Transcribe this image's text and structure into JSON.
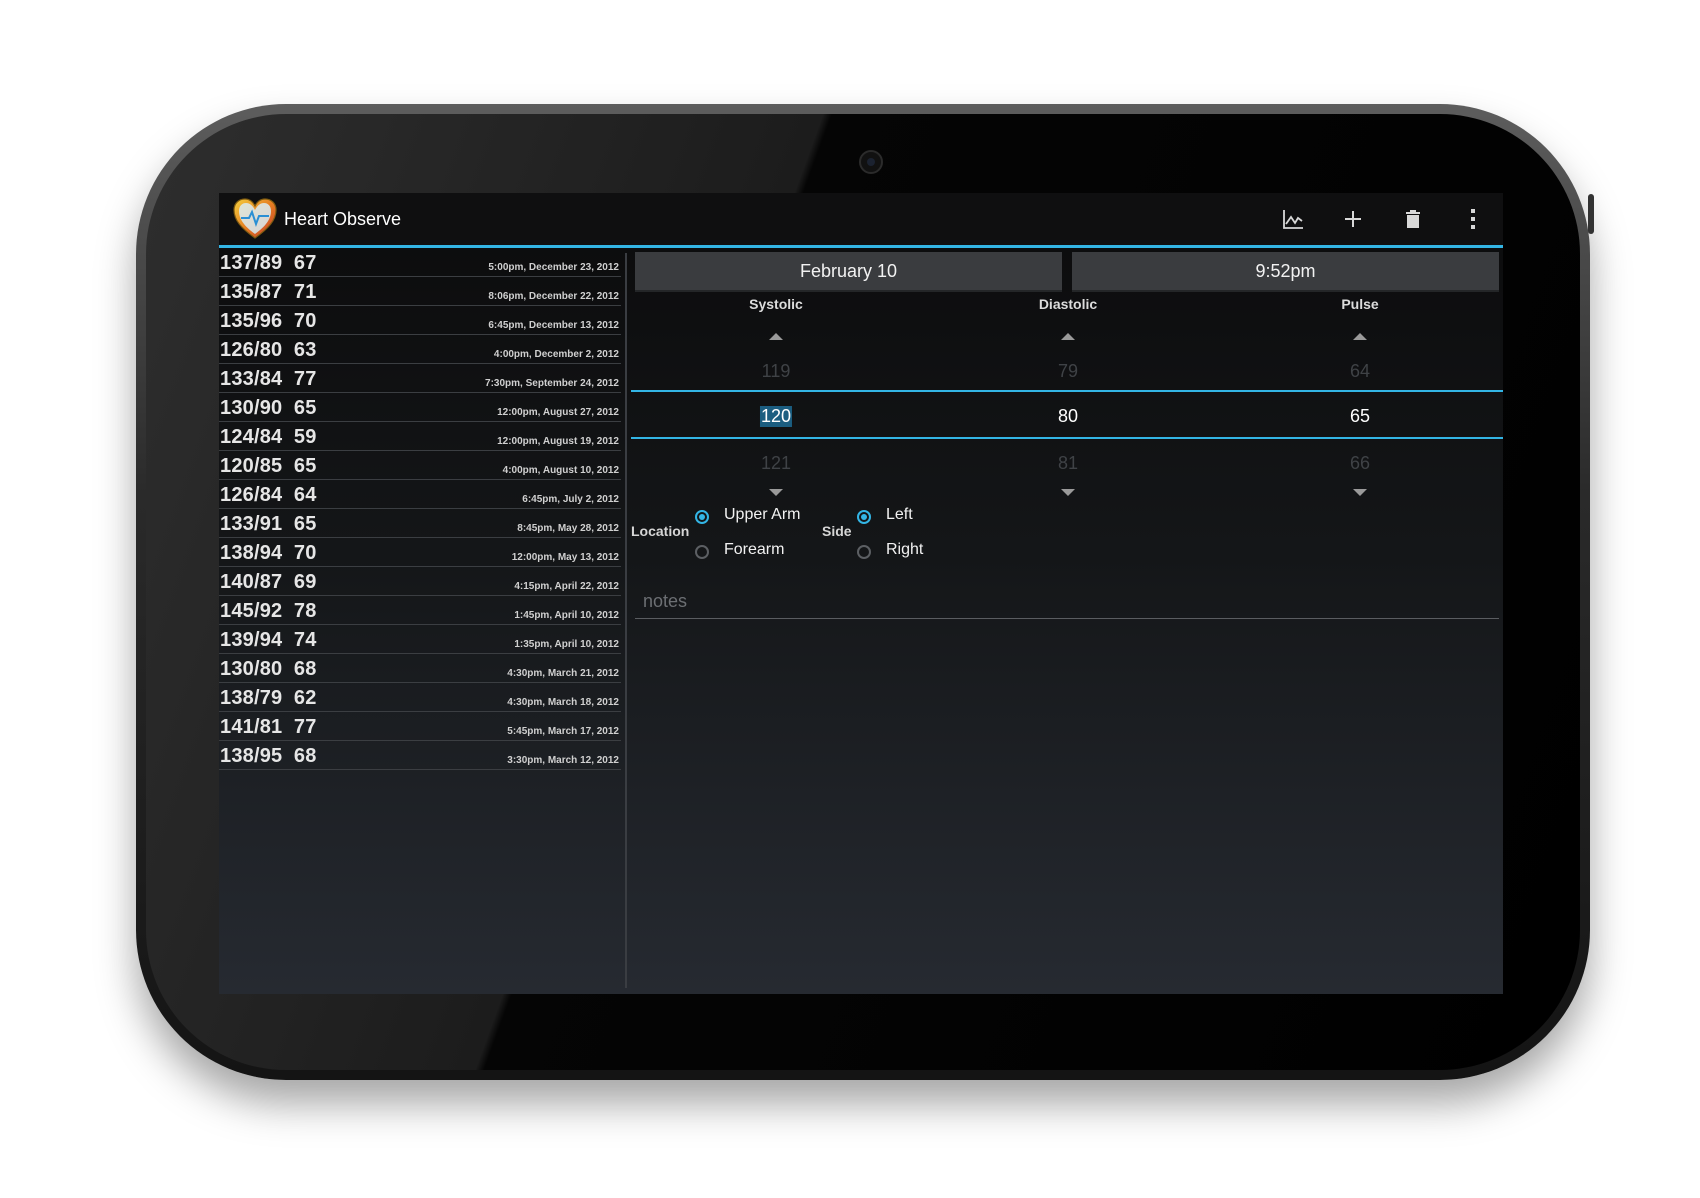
{
  "app": {
    "title": "Heart Observe",
    "icon": "heart-logo-icon"
  },
  "actions": [
    {
      "name": "chart-button",
      "icon": "chart-line-icon"
    },
    {
      "name": "add-button",
      "icon": "plus-icon"
    },
    {
      "name": "delete-button",
      "icon": "trash-icon"
    },
    {
      "name": "overflow-menu-button",
      "icon": "more-vertical-icon"
    }
  ],
  "readings": [
    {
      "bp": "137/89",
      "pulse": "67",
      "when": "5:00pm, December 23, 2012"
    },
    {
      "bp": "135/87",
      "pulse": "71",
      "when": "8:06pm, December 22, 2012"
    },
    {
      "bp": "135/96",
      "pulse": "70",
      "when": "6:45pm, December 13, 2012"
    },
    {
      "bp": "126/80",
      "pulse": "63",
      "when": "4:00pm, December 2, 2012"
    },
    {
      "bp": "133/84",
      "pulse": "77",
      "when": "7:30pm, September 24, 2012"
    },
    {
      "bp": "130/90",
      "pulse": "65",
      "when": "12:00pm, August 27, 2012"
    },
    {
      "bp": "124/84",
      "pulse": "59",
      "when": "12:00pm, August 19, 2012"
    },
    {
      "bp": "120/85",
      "pulse": "65",
      "when": "4:00pm, August 10, 2012"
    },
    {
      "bp": "126/84",
      "pulse": "64",
      "when": "6:45pm, July 2, 2012"
    },
    {
      "bp": "133/91",
      "pulse": "65",
      "when": "8:45pm, May 28, 2012"
    },
    {
      "bp": "138/94",
      "pulse": "70",
      "when": "12:00pm, May 13, 2012"
    },
    {
      "bp": "140/87",
      "pulse": "69",
      "when": "4:15pm, April 22, 2012"
    },
    {
      "bp": "145/92",
      "pulse": "78",
      "when": "1:45pm, April 10, 2012"
    },
    {
      "bp": "139/94",
      "pulse": "74",
      "when": "1:35pm, April 10, 2012"
    },
    {
      "bp": "130/80",
      "pulse": "68",
      "when": "4:30pm, March 21, 2012"
    },
    {
      "bp": "138/79",
      "pulse": "62",
      "when": "4:30pm, March 18, 2012"
    },
    {
      "bp": "141/81",
      "pulse": "77",
      "when": "5:45pm, March 17, 2012"
    },
    {
      "bp": "138/95",
      "pulse": "68",
      "when": "3:30pm, March 12, 2012"
    }
  ],
  "editor": {
    "date": "February 10",
    "time": "9:52pm",
    "systolic": {
      "label": "Systolic",
      "prev": "119",
      "value": "120",
      "next": "121"
    },
    "diastolic": {
      "label": "Diastolic",
      "prev": "79",
      "value": "80",
      "next": "81"
    },
    "pulse": {
      "label": "Pulse",
      "prev": "64",
      "value": "65",
      "next": "66"
    },
    "location": {
      "label": "Location",
      "options": [
        "Upper Arm",
        "Forearm"
      ],
      "selected": "Upper Arm"
    },
    "side": {
      "label": "Side",
      "options": [
        "Left",
        "Right"
      ],
      "selected": "Left"
    },
    "notes": {
      "placeholder": "notes",
      "value": ""
    }
  },
  "colors": {
    "accent": "#33b5e5",
    "background": "#141618",
    "actionbar": "#0f0f10"
  }
}
